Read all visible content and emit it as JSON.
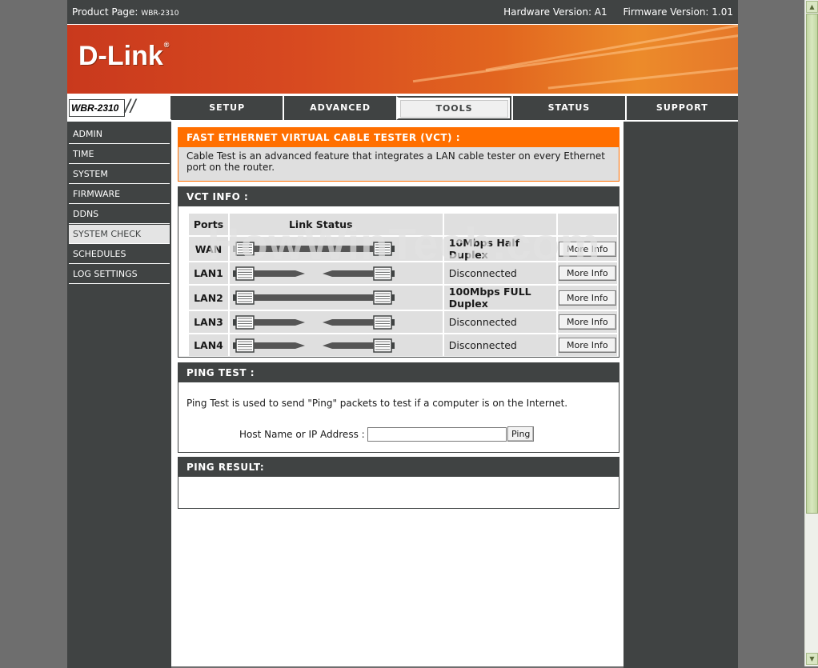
{
  "topbar": {
    "product_label": "Product Page:",
    "product_model": "WBR-2310",
    "hardware_version": "Hardware Version: A1",
    "firmware_version": "Firmware Version: 1.01"
  },
  "brand": {
    "logo_text": "D-Link",
    "logo_reg": "®",
    "model_tag": "WBR-2310"
  },
  "nav": {
    "tabs": [
      {
        "label": "SETUP",
        "active": false
      },
      {
        "label": "ADVANCED",
        "active": false
      },
      {
        "label": "TOOLS",
        "active": true
      },
      {
        "label": "STATUS",
        "active": false
      },
      {
        "label": "SUPPORT",
        "active": false
      }
    ]
  },
  "sidebar": {
    "items": [
      {
        "label": "ADMIN",
        "active": false
      },
      {
        "label": "TIME",
        "active": false
      },
      {
        "label": "SYSTEM",
        "active": false
      },
      {
        "label": "FIRMWARE",
        "active": false
      },
      {
        "label": "DDNS",
        "active": false
      },
      {
        "label": "SYSTEM CHECK",
        "active": true
      },
      {
        "label": "SCHEDULES",
        "active": false
      },
      {
        "label": "LOG SETTINGS",
        "active": false
      }
    ]
  },
  "vct": {
    "title": "FAST ETHERNET VIRTUAL CABLE TESTER (VCT) :",
    "description": "Cable Test is an advanced feature that integrates a LAN cable tester on every Ethernet port on the router."
  },
  "vct_info": {
    "title": "VCT INFO :",
    "headers": {
      "ports": "Ports",
      "link_status": "Link Status"
    },
    "rows": [
      {
        "port": "WAN",
        "status": "10Mbps Half Duplex",
        "connected": true,
        "button": "More Info"
      },
      {
        "port": "LAN1",
        "status": "Disconnected",
        "connected": false,
        "button": "More Info"
      },
      {
        "port": "LAN2",
        "status": "100Mbps FULL Duplex",
        "connected": true,
        "button": "More Info"
      },
      {
        "port": "LAN3",
        "status": "Disconnected",
        "connected": false,
        "button": "More Info"
      },
      {
        "port": "LAN4",
        "status": "Disconnected",
        "connected": false,
        "button": "More Info"
      }
    ]
  },
  "ping_test": {
    "title": "PING TEST :",
    "description": "Ping Test is used to send \"Ping\" packets to test if a computer is on the Internet.",
    "host_label": "Host Name or IP Address :",
    "host_value": "",
    "button": "Ping"
  },
  "ping_result": {
    "title": "PING RESULT:"
  },
  "watermark": "HowWinTech.com",
  "colors": {
    "dark": "#404343",
    "orange": "#ff6f00",
    "panel_gray": "#dfdfdf"
  },
  "scrollbar": {
    "up_icon": "triangle-up-icon",
    "down_icon": "triangle-down-icon"
  }
}
